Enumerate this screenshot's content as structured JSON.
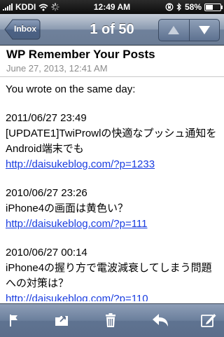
{
  "status": {
    "carrier": "KDDI",
    "time": "12:49 AM",
    "battery": "58%",
    "battery_level": 0.58
  },
  "nav": {
    "back_label": "Inbox",
    "position_text": "1 of 50"
  },
  "message": {
    "subject": "WP Remember Your Posts",
    "date": "June 27, 2013, 12:41 AM",
    "intro": "You wrote on the same day:",
    "entries": [
      {
        "datetime": "2011/06/27 23:49",
        "title_line1": "[UPDATE1]TwiProwlの快適なプッシュ通知を",
        "title_line2": "Android端末でも",
        "link": "http://daisukeblog.com/?p=1233"
      },
      {
        "datetime": "2010/06/27 23:26",
        "title_line1": "iPhone4の画面は黄色い？",
        "title_line2": "",
        "link": "http://daisukeblog.com/?p=111"
      },
      {
        "datetime": "2010/06/27 00:14",
        "title_line1": "iPhone4の握り方で電波減衰してしまう問題",
        "title_line2": "への対策は？",
        "link": "http://daisukeblog.com/?p=110"
      }
    ]
  },
  "toolbar": {
    "icons": [
      "flag-icon",
      "move-folder-icon",
      "trash-icon",
      "reply-icon",
      "compose-icon"
    ]
  }
}
